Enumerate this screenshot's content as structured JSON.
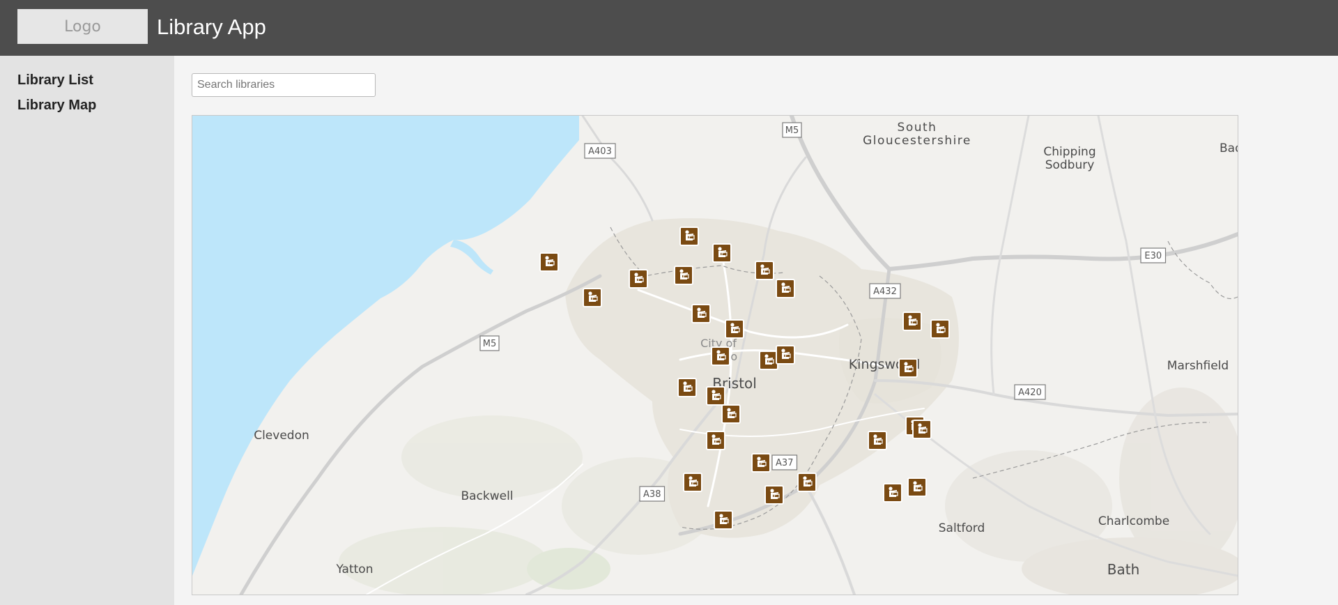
{
  "header": {
    "logo": "Logo",
    "title": "Library App"
  },
  "sidebar": {
    "items": [
      {
        "label": "Library List"
      },
      {
        "label": "Library Map"
      }
    ]
  },
  "search": {
    "placeholder": "Search libraries"
  },
  "map": {
    "colors": {
      "water": "#bde6fa",
      "land": "#f2f1ee",
      "urban": "#e8e5dd",
      "marker": "#7a4a12",
      "marker_border": "#ffffff"
    },
    "place_labels": [
      {
        "id": "south-glos",
        "text": "South"
      },
      {
        "id": "south-glos-2",
        "text": "Gloucestershire"
      },
      {
        "id": "chipping",
        "text": "Chipping"
      },
      {
        "id": "sodbury",
        "text": "Sodbury"
      },
      {
        "id": "bad",
        "text": "Bad"
      },
      {
        "id": "kingswood",
        "text": "Kingswood"
      },
      {
        "id": "marshfield",
        "text": "Marshfield"
      },
      {
        "id": "bristol",
        "text": "Bristol"
      },
      {
        "id": "city-of",
        "text": "City of"
      },
      {
        "id": "bristol-partial",
        "text": "sto"
      },
      {
        "id": "clevedon",
        "text": "Clevedon"
      },
      {
        "id": "backwell",
        "text": "Backwell"
      },
      {
        "id": "yatton",
        "text": "Yatton"
      },
      {
        "id": "saltford",
        "text": "Saltford"
      },
      {
        "id": "charlcombe",
        "text": "Charlcombe"
      },
      {
        "id": "bath",
        "text": "Bath"
      }
    ],
    "road_shields": [
      {
        "id": "m5-north",
        "text": "M5"
      },
      {
        "id": "a403",
        "text": "A403"
      },
      {
        "id": "a432",
        "text": "A432"
      },
      {
        "id": "e30",
        "text": "E30"
      },
      {
        "id": "m5-west",
        "text": "M5"
      },
      {
        "id": "a420",
        "text": "A420"
      },
      {
        "id": "a37",
        "text": "A37"
      },
      {
        "id": "a38",
        "text": "A38"
      }
    ],
    "library_count": 30,
    "marker_icon": "library-reading-icon"
  }
}
